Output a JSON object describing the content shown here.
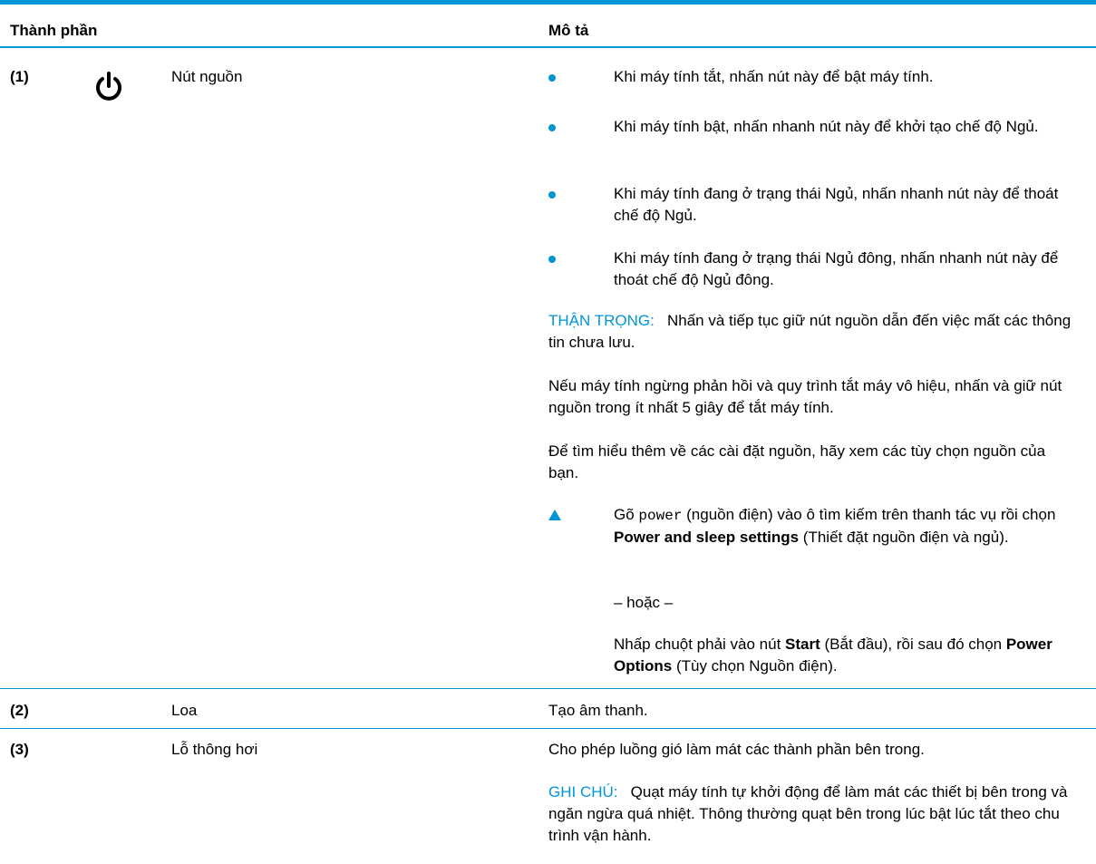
{
  "header": {
    "component": "Thành phần",
    "description": "Mô tả"
  },
  "rows": [
    {
      "num": "(1)",
      "name": "Nút nguồn",
      "bullets": [
        "Khi máy tính tắt, nhấn nút này để bật máy tính.",
        "Khi máy tính bật, nhấn nhanh nút này để khởi tạo chế độ Ngủ.",
        "Khi máy tính đang ở trạng thái Ngủ, nhấn nhanh nút này để thoát chế độ Ngủ.",
        "Khi máy tính đang ở trạng thái Ngủ đông, nhấn nhanh nút này để thoát chế độ Ngủ đông."
      ],
      "caution_label": "THẬN TRỌNG:",
      "caution_text": "Nhấn và tiếp tục giữ nút nguồn dẫn đến việc mất các thông tin chưa lưu.",
      "para1": "Nếu máy tính ngừng phản hồi và quy trình tắt máy vô hiệu, nhấn và giữ nút nguồn trong ít nhất 5 giây để tắt máy tính.",
      "para2": "Để tìm hiểu thêm về các cài đặt nguồn, hãy xem các tùy chọn nguồn của bạn.",
      "step_pre": "Gõ ",
      "step_code": "power",
      "step_mid": " (nguồn điện) vào ô tìm kiếm trên thanh tác vụ rồi chọn ",
      "step_bold": "Power and sleep settings",
      "step_post": " (Thiết đặt nguồn điện và ngủ).",
      "or_text": "– hoặc –",
      "alt_pre": "Nhấp chuột phải vào nút ",
      "alt_bold1": "Start",
      "alt_mid": " (Bắt đầu), rồi sau đó chọn ",
      "alt_bold2": "Power Options",
      "alt_post": " (Tùy chọn Nguồn điện)."
    },
    {
      "num": "(2)",
      "name": "Loa",
      "description": "Tạo âm thanh."
    },
    {
      "num": "(3)",
      "name": "Lỗ thông hơi",
      "description": "Cho phép luồng gió làm mát các thành phần bên trong.",
      "note_label": "GHI CHÚ:",
      "note_text": "Quạt máy tính tự khởi động để làm mát các thiết bị bên trong và ngăn ngừa quá nhiệt. Thông thường quạt bên trong lúc bật lúc tắt theo chu trình vận hành."
    }
  ],
  "colors": {
    "accent": "#0096d6"
  }
}
